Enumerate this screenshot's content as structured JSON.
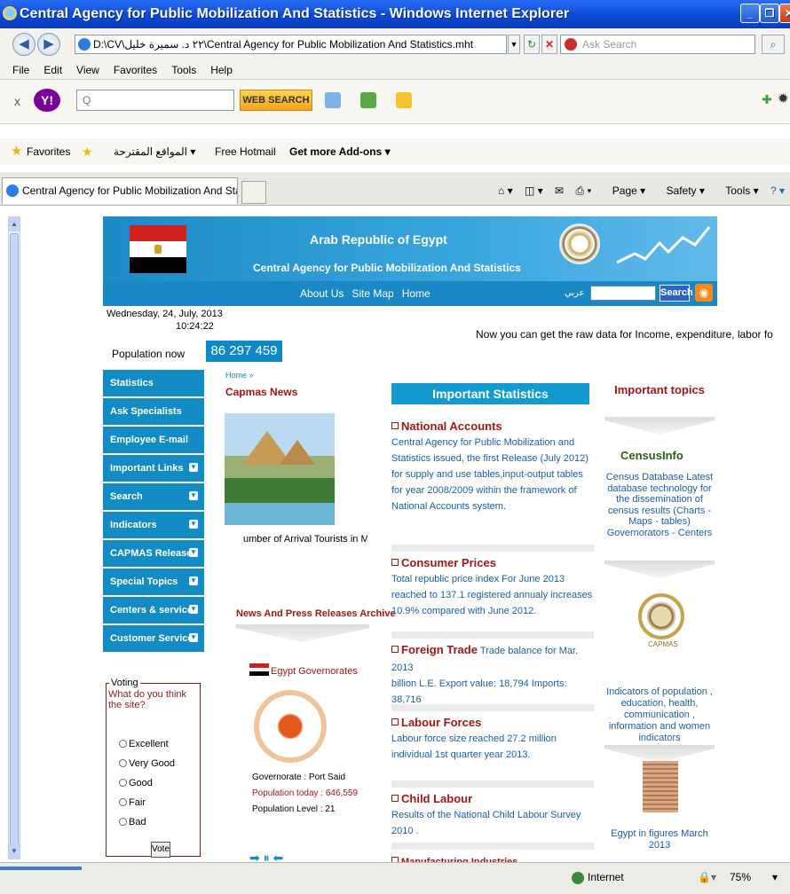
{
  "window": {
    "title": "Central Agency for Public Mobilization And Statistics - Windows Internet Explorer"
  },
  "address": {
    "url": "D:\\CV\\٢٢ د. سميرة خليل\\Central Agency for Public Mobilization And Statistics.mht",
    "search_placeholder": "Ask Search"
  },
  "menu": [
    "File",
    "Edit",
    "View",
    "Favorites",
    "Tools",
    "Help"
  ],
  "toolbar": {
    "web_search": "WEB SEARCH",
    "search_glyph": "Q"
  },
  "favorites": {
    "label": "Favorites",
    "item1": "المواقع المقترحة",
    "item2": "Free Hotmail",
    "item3": "Get more Add-ons"
  },
  "tab": {
    "title": "Central Agency for Public Mobilization And Statistics"
  },
  "commands": {
    "page": "Page",
    "safety": "Safety",
    "tools": "Tools"
  },
  "site": {
    "banner_title": "Arab Republic of Egypt",
    "banner_subtitle": "Central Agency for Public Mobilization And Statistics",
    "nav": [
      "About Us",
      "Site Map",
      "Home"
    ],
    "arabic_link": "عربي",
    "search_button": "Search",
    "date": "Wednesday, 24, July, 2013",
    "time": "10:24:22",
    "population_label": "Population now",
    "population_value": "86 297 459",
    "ticker": "Now you can get the raw data for Income, expenditure, labor fo"
  },
  "left_menu": [
    {
      "label": "Statistics",
      "chevron": false
    },
    {
      "label": "Ask Specialists",
      "chevron": false
    },
    {
      "label": "Employee E-mail",
      "chevron": false
    },
    {
      "label": "Important Links",
      "chevron": true
    },
    {
      "label": "Search",
      "chevron": true
    },
    {
      "label": "Indicators",
      "chevron": true
    },
    {
      "label": "CAPMAS Releases",
      "chevron": true
    },
    {
      "label": "Special Topics",
      "chevron": true
    },
    {
      "label": "Centers & services",
      "chevron": true
    },
    {
      "label": "Customer Service",
      "chevron": true
    }
  ],
  "voting": {
    "legend": "Voting",
    "question": "What do you think the site?",
    "options": [
      "Excellent",
      "Very Good",
      "Good",
      "Fair",
      "Bad"
    ],
    "button": "Vote"
  },
  "news": {
    "breadcrumb": "Home »",
    "title": "Capmas News",
    "caption": "umber of Arrival Tourists in Ma",
    "archive": "News And Press Releases Archive"
  },
  "governorate": {
    "link": "Egypt Governorates",
    "name": "Governorate : Port Said",
    "population": "Population today : 646,559",
    "level": "Population Level : 21"
  },
  "stats": {
    "heading": "Important Statistics",
    "items": [
      {
        "title": "National Accounts",
        "inline": "",
        "body": "Central Agency for Public Mobilization and Statistics issued, the first Release (July 2012) for supply and use tables,input-output tables for year 2008/2009 within the framework of National Accounts system."
      },
      {
        "title": "Consumer Prices",
        "inline": "",
        "body": "Total republic price index For June 2013 reached to 137.1 registered annualy increases 10.9% compared with June 2012."
      },
      {
        "title": "Foreign Trade",
        "inline": " Trade balance for Mar. 2013",
        "body": "billion L.E. Export value: 18,794 Imports: 38,716"
      },
      {
        "title": "Labour Forces",
        "inline": "",
        "body": "Labour force size reached 27.2 million individual 1st quarter year 2013."
      },
      {
        "title": "Child Labour",
        "inline": "",
        "body": "Results of the National Child Labour Survey 2010 ."
      },
      {
        "title": "Manufacturing Industries",
        "inline": "",
        "body": ""
      }
    ]
  },
  "topics": {
    "heading": "Important topics",
    "census_logo": "CensusInfo",
    "census_text": "Census Database Latest database technology for the dissemination of census results (Charts - Maps - tables) Governorators - Centers",
    "capmas_logo": "CAPMAS",
    "indicators_text": "Indicators of population , education, health, communication , information and women indicators",
    "figures_text": "Egypt in figures March 2013"
  },
  "status": {
    "zone": "Internet",
    "zoom": "75%"
  }
}
